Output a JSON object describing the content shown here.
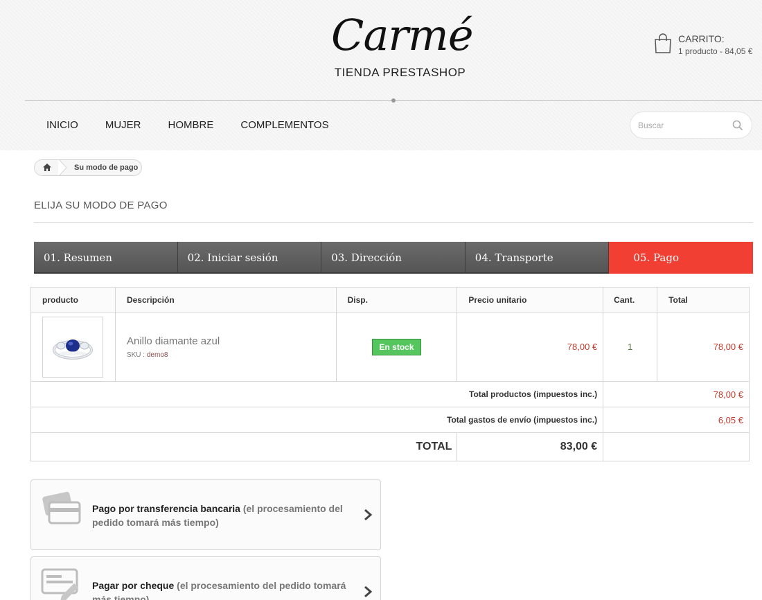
{
  "header": {
    "logo_script": "Carmé",
    "logo_sub": "TIENDA PRESTASHOP",
    "cart_title": "CARRITO:",
    "cart_summary": "1 producto - 84,05 €"
  },
  "nav": [
    "INICIO",
    "MUJER",
    "HOMBRE",
    "COMPLEMENTOS"
  ],
  "search": {
    "placeholder": "Buscar"
  },
  "breadcrumb": {
    "current": "Su modo de pago"
  },
  "page_title": "ELIJA SU MODO DE PAGO",
  "steps": [
    "01. Resumen",
    "02. Iniciar sesión",
    "03. Dirección",
    "04. Transporte",
    "05. Pago"
  ],
  "table": {
    "headers": [
      "producto",
      "Descripción",
      "Disp.",
      "Precio unitario",
      "Cant.",
      "Total"
    ],
    "product": {
      "name": "Anillo diamante azul",
      "sku_label": "SKU : ",
      "sku": "demo8",
      "availability": "En stock",
      "unit_price": "78,00 €",
      "qty": "1",
      "total": "78,00 €"
    },
    "summary": [
      {
        "label": "Total productos (impuestos inc.)",
        "value": "78,00 €"
      },
      {
        "label": "Total gastos de envío (impuestos inc.)",
        "value": "6,05 €"
      }
    ],
    "total_label": "TOTAL",
    "total_value": "83,00 €"
  },
  "payments": [
    {
      "title": "Pago por transferencia bancaria",
      "note": " (el procesamiento del pedido tomará más tiempo)",
      "icon": "bank-card-icon"
    },
    {
      "title": "Pagar por cheque",
      "note": " (el procesamiento del pedido tomará más tiempo)",
      "icon": "cheque-icon"
    }
  ],
  "colors": {
    "accent": "#f13f34",
    "step_bg": "#5f5f5f",
    "stock": "#55c65e",
    "price": "#c0392b"
  }
}
